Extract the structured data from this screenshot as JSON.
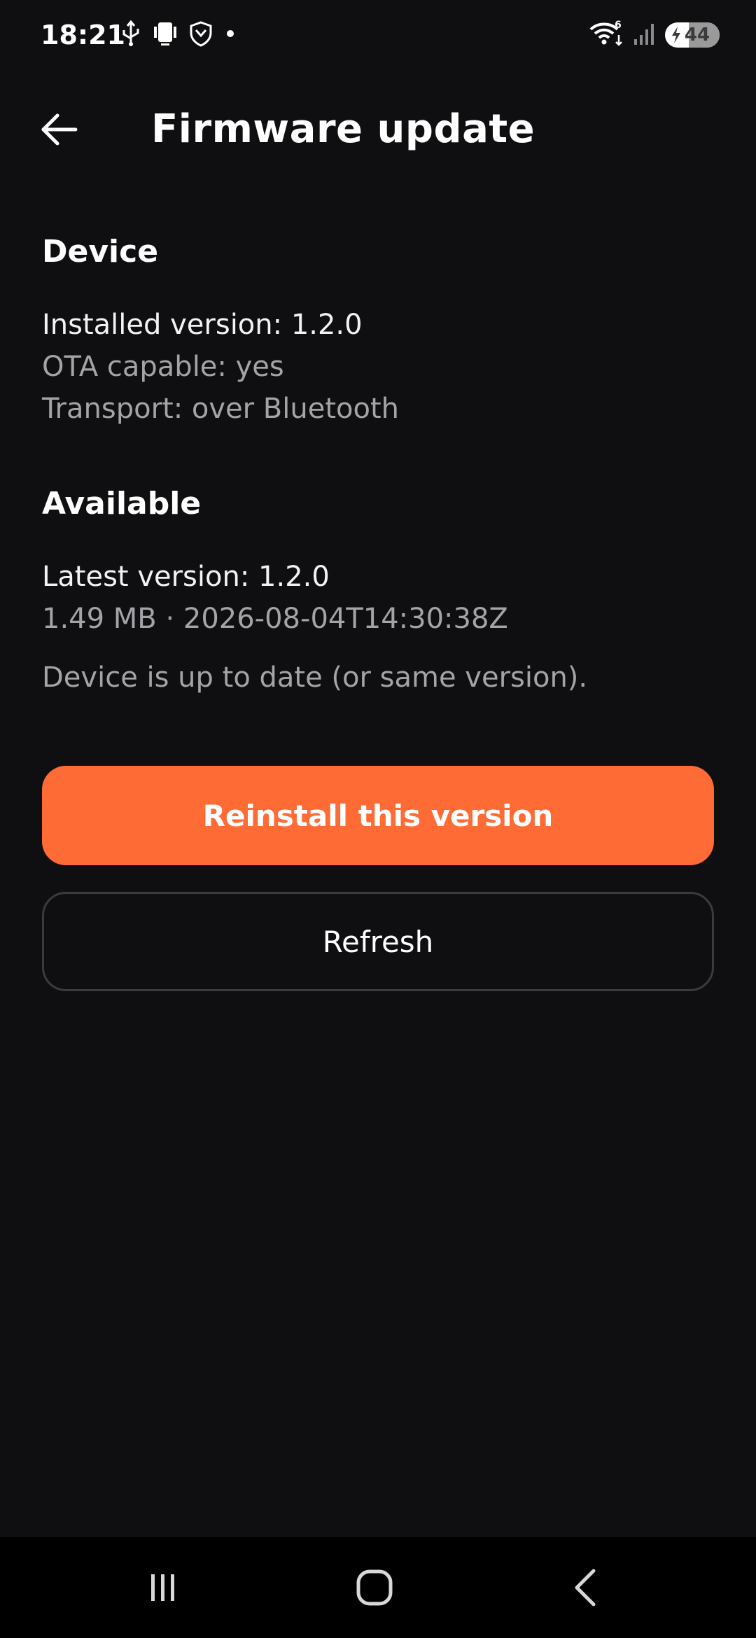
{
  "status_bar": {
    "time": "18:21",
    "left_icons": [
      "usb-icon",
      "phone-connection-icon",
      "shield-icon",
      "dot-icon"
    ],
    "right_icons": [
      "wifi-6-icon",
      "signal-icon",
      "battery-charging-icon"
    ],
    "battery_level": "44"
  },
  "app_bar": {
    "back_icon": "arrow-left-icon",
    "title": "Firmware update"
  },
  "device_section": {
    "title": "Device",
    "installed_version": "Installed version: 1.2.0",
    "ota_capable": "OTA capable: yes",
    "transport": "Transport: over Bluetooth"
  },
  "available_section": {
    "title": "Available",
    "latest_version": "Latest version: 1.2.0",
    "size_and_date": "1.49 MB · 2026-08-04T14:30:38Z",
    "status_message": "Device is up to date (or same version)."
  },
  "actions": {
    "reinstall_label": "Reinstall this version",
    "refresh_label": "Refresh"
  },
  "nav_bar": {
    "recents_icon": "recents-icon",
    "home_icon": "home-icon",
    "back_icon": "back-chevron-icon"
  },
  "colors": {
    "background": "#0f0f11",
    "accent": "#ff6b35",
    "secondary_text": "#a3a3a8",
    "outline": "#3a3a40"
  }
}
